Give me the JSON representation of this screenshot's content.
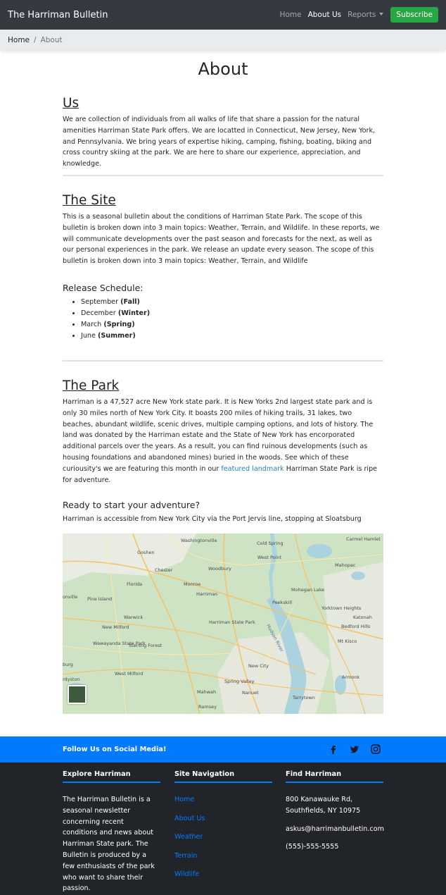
{
  "navbar": {
    "brand": "The Harriman Bulletin",
    "links": [
      {
        "label": "Home"
      },
      {
        "label": "About Us"
      },
      {
        "label": "Reports"
      }
    ],
    "subscribe": "Subscribe"
  },
  "breadcrumb": {
    "home": "Home",
    "separator": "/",
    "current": "About"
  },
  "page_title": "About",
  "us": {
    "heading": "Us",
    "text": "We are collection of individuals from all walks of life that share a passion for the natural amenities Harriman State Park offers. We are locatted in Connecticut, New Jersey, New York, and Pennsylvania. We bring years of expertise hiking, camping, fishing, boating, biking and cross country skiing at the park. We are here to share our experience, appreciation, and knowledge."
  },
  "site": {
    "heading": "The Site",
    "text": "This is a seasonal bulletin about the conditions of Harriman State Park. The scope of this bulletin is broken down into 3 main topics: Weather, Terrain, and Wildlife. In these reports, we will communicate developments over the past season and forecasts for the next, as well as our personal experiences in the park. We release an update every season. The scope of this bulletin is broken down into 3 main topics: Weather, Terrain, and Wildlife",
    "schedule_heading": "Release Schedule:",
    "schedule": [
      {
        "month": "September",
        "season": "(Fall)"
      },
      {
        "month": "December",
        "season": "(Winter)"
      },
      {
        "month": "March",
        "season": "(Spring)"
      },
      {
        "month": "June",
        "season": "(Summer)"
      }
    ]
  },
  "park": {
    "heading": "The Park",
    "text_before_link": "Harriman is a 47,527 acre New York state park. It is New Yorks 2nd largest state park and is only 30 miles north of New York City. It boasts 200 miles of hiking trails, 31 lakes, two beaches, abundant wildlife, scenic drives, multiple camping options, and lots of history. The land was donated by the Harriman estate and the State of New York has encorporated additional parcels over the years. As a result, you can find ruinous developments (such as housing foundations and abandoned mines) buried in the woods. See which of these curiousity's we are featuring this month in our",
    "link": "featured landmark",
    "text_after_link": "Harriman State Park is ripe for adventure.",
    "adventure_heading": "Ready to start your adventure?",
    "adventure_text": "Harriman is accessible from New York City via the Port Jervis line, stopping at Sloatsburg"
  },
  "map": {
    "labels": {
      "washingtonville": "Washingtonville",
      "cold_spring": "Cold Spring",
      "carmel": "Carmel Hamlet",
      "goshen": "Goshen",
      "west_point": "West Point",
      "mahopac": "Mahopac",
      "chester": "Chester",
      "woodbury": "Woodbury",
      "florida": "Florida",
      "monroe": "Monroe",
      "harriman": "Harriman",
      "mohegan": "Mohegan Lake",
      "pine_island": "Pine Island",
      "peekskill": "Peekskill",
      "yorktown": "Yorktown Heights",
      "warwick": "Warwick",
      "katonah": "Katonah",
      "new_milford": "New Milford",
      "harriman_park": "Harriman State Park",
      "bedford": "Bedford Hills",
      "hudson": "Hudson River",
      "wawayanda": "Wawayanda State Park",
      "sterling": "Sterling Forest",
      "mt_kisco": "Mt Kisco",
      "new_city": "New City",
      "armonk": "Armonk",
      "west_milford": "West Milford",
      "spring_valley": "Spring Valley",
      "mahwah": "Mahwah",
      "nanuet": "Nanuet",
      "tarrytown": "Tarrytown",
      "ramsey": "Ramsey",
      "onville": "onville",
      "burg": "burg",
      "rdyston": "rdyston"
    }
  },
  "social": {
    "text": "Follow Us on Social Media!",
    "icons": [
      "facebook-icon",
      "twitter-icon",
      "instagram-icon"
    ]
  },
  "footer": {
    "explore": {
      "heading": "Explore Harriman",
      "text": "The Harriman Bulletin is a seasonal newsletter concerning recent conditions and news about Harriman State park. The Bulletin is produced by a few enthusiasts of the park who want to share their passion."
    },
    "navigation": {
      "heading": "Site Navigation",
      "links": [
        "Home",
        "About Us",
        "Weather",
        "Terrain",
        "Wildlife"
      ]
    },
    "find": {
      "heading": "Find Harriman",
      "address": "800 Kanawauke Rd, Southfields, NY 10975",
      "email": "askus@harrimanbulletin.com",
      "phone": "(555)-555-5555"
    }
  },
  "colors": {
    "navbar_bg": "#343a40",
    "subscribe_bg": "#28a745",
    "social_bg": "#007bff",
    "footer_bg": "#212529",
    "link": "#007bff"
  }
}
